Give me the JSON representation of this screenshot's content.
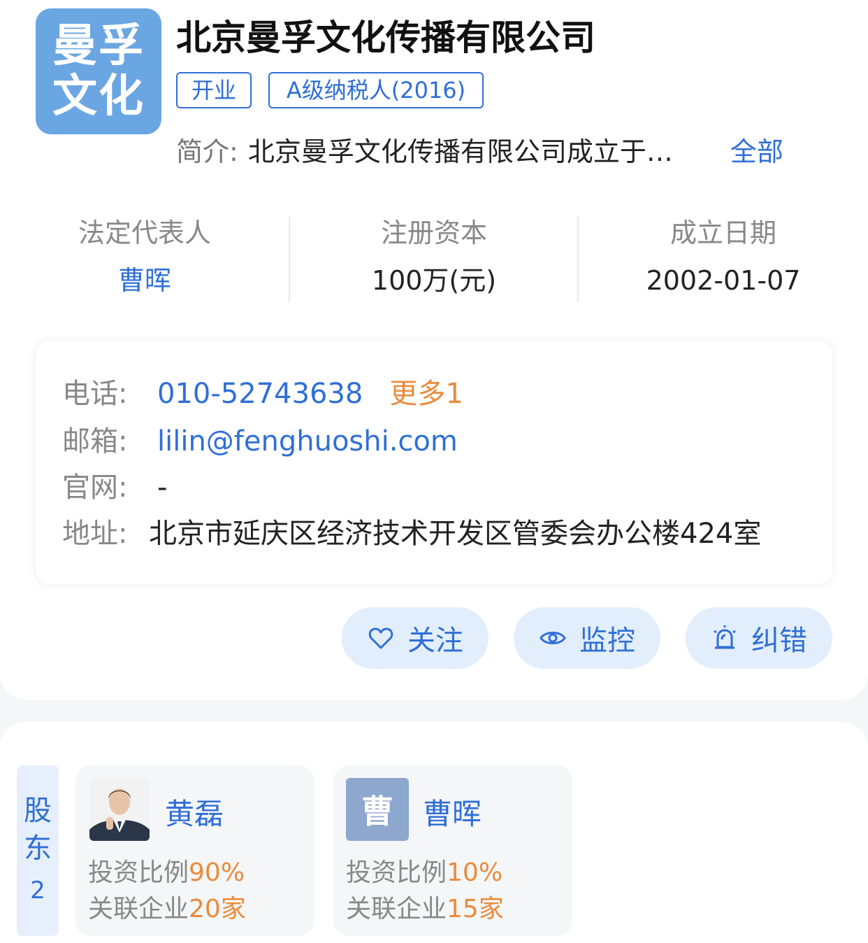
{
  "company": {
    "logo_line1": "曼孚",
    "logo_line2": "文化",
    "name": "北京曼孚文化传播有限公司",
    "tags": [
      "开业",
      "A级纳税人(2016)"
    ],
    "intro_label": "简介:",
    "intro_text": "北京曼孚文化传播有限公司成立于…",
    "intro_more": "全部"
  },
  "stats": [
    {
      "label": "法定代表人",
      "value": "曹晖"
    },
    {
      "label": "注册资本",
      "value": "100万(元)"
    },
    {
      "label": "成立日期",
      "value": "2002-01-07"
    }
  ],
  "contact": {
    "phone_label": "电话:",
    "phone": "010-52743638",
    "phone_more": "更多1",
    "email_label": "邮箱:",
    "email": "lilin@fenghuoshi.com",
    "website_label": "官网:",
    "website": "-",
    "address_label": "地址:",
    "address": "北京市延庆区经济技术开发区管委会办公楼424室"
  },
  "actions": {
    "follow": "关注",
    "monitor": "监控",
    "correct": "纠错"
  },
  "shareholders": {
    "tab_label_1": "股",
    "tab_label_2": "东",
    "count": "2",
    "items": [
      {
        "name": "黄磊",
        "ratio_label": "投资比例",
        "ratio": "90%",
        "assoc_label": "关联企业",
        "assoc": "20家",
        "avatar_type": "photo"
      },
      {
        "name": "曹晖",
        "avatar_text": "曹",
        "ratio_label": "投资比例",
        "ratio": "10%",
        "assoc_label": "关联企业",
        "assoc": "15家",
        "avatar_type": "text"
      }
    ]
  },
  "colors": {
    "accent": "#2f6fd6",
    "orange": "#e98b3a",
    "logo_bg": "#6aa6e2"
  }
}
